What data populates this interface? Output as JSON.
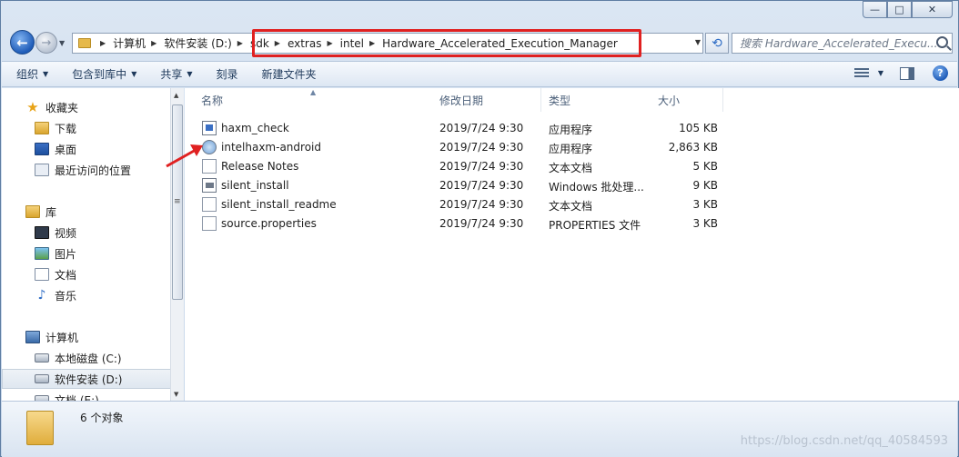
{
  "window": {
    "caption_min": "—",
    "caption_max": "□",
    "caption_close": "✕"
  },
  "address": {
    "crumbs": [
      "计算机",
      "软件安装 (D:)",
      "sdk",
      "extras",
      "intel",
      "Hardware_Accelerated_Execution_Manager"
    ],
    "search_placeholder": "搜索 Hardware_Accelerated_Execu..."
  },
  "toolbar": {
    "organize": "组织",
    "include_in_library": "包含到库中",
    "share": "共享",
    "burn": "刻录",
    "new_folder": "新建文件夹"
  },
  "nav": {
    "favorites": "收藏夹",
    "downloads": "下载",
    "desktop": "桌面",
    "recent": "最近访问的位置",
    "libraries": "库",
    "videos": "视频",
    "pictures": "图片",
    "documents": "文档",
    "music": "音乐",
    "computer": "计算机",
    "drive_c": "本地磁盘 (C:)",
    "drive_d": "软件安装 (D:)",
    "drive_e": "文档 (E:)"
  },
  "columns": {
    "name": "名称",
    "date": "修改日期",
    "type": "类型",
    "size": "大小"
  },
  "files": [
    {
      "name": "haxm_check",
      "date": "2019/7/24 9:30",
      "type": "应用程序",
      "size": "105 KB",
      "icon": "exe-icon"
    },
    {
      "name": "intelhaxm-android",
      "date": "2019/7/24 9:30",
      "type": "应用程序",
      "size": "2,863 KB",
      "icon": "setup-icon"
    },
    {
      "name": "Release Notes",
      "date": "2019/7/24 9:30",
      "type": "文本文档",
      "size": "5 KB",
      "icon": "text-file-icon"
    },
    {
      "name": "silent_install",
      "date": "2019/7/24 9:30",
      "type": "Windows 批处理...",
      "size": "9 KB",
      "icon": "batch-file-icon"
    },
    {
      "name": "silent_install_readme",
      "date": "2019/7/24 9:30",
      "type": "文本文档",
      "size": "3 KB",
      "icon": "text-file-icon"
    },
    {
      "name": "source.properties",
      "date": "2019/7/24 9:30",
      "type": "PROPERTIES 文件",
      "size": "3 KB",
      "icon": "text-file-icon"
    }
  ],
  "status": {
    "count": "6 个对象",
    "watermark": "https://blog.csdn.net/qq_40584593"
  },
  "colors": {
    "highlight": "#e02121",
    "arrow": "#e02121"
  }
}
